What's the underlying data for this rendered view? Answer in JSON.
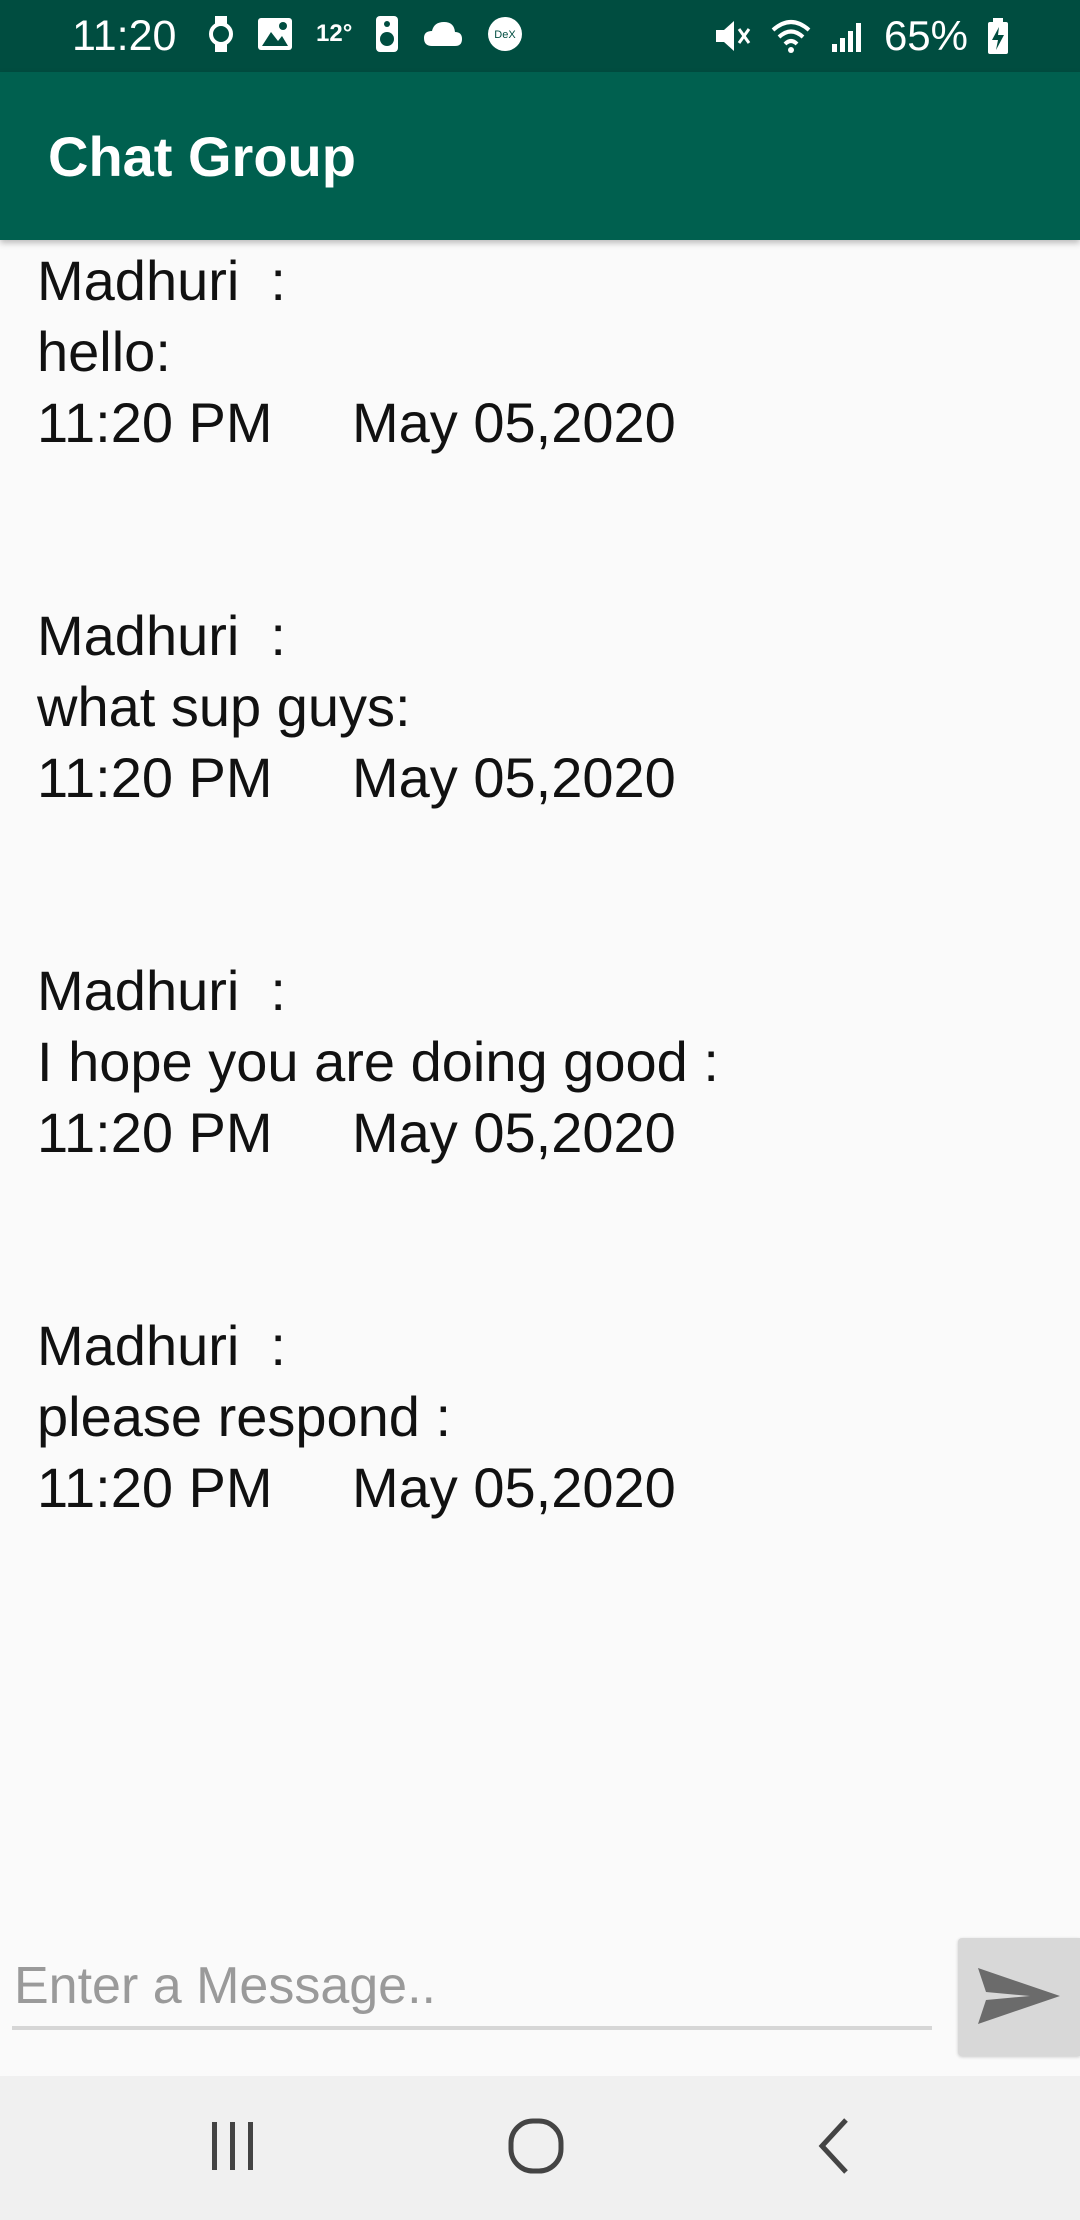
{
  "status_bar": {
    "time": "11:20",
    "temperature": "12°",
    "battery": "65%",
    "icons": [
      "watch-icon",
      "image-icon",
      "temperature-icon",
      "speaker-icon",
      "cloud-icon",
      "dex-icon",
      "mute-icon",
      "wifi-icon",
      "signal-icon",
      "battery-charging-icon"
    ],
    "dex_label": "DeX"
  },
  "app_bar": {
    "title": "Chat Group"
  },
  "messages": [
    {
      "sender": "Madhuri  :",
      "text": "hello:",
      "time": "11:20 PM",
      "date": "May 05,2020"
    },
    {
      "sender": "Madhuri  :",
      "text": "what sup guys:",
      "time": "11:20 PM",
      "date": "May 05,2020"
    },
    {
      "sender": "Madhuri  :",
      "text": "I hope you are doing good :",
      "time": "11:20 PM",
      "date": "May 05,2020"
    },
    {
      "sender": "Madhuri  :",
      "text": "please respond :",
      "time": "11:20 PM",
      "date": "May 05,2020"
    }
  ],
  "composer": {
    "placeholder": "Enter a Message..",
    "value": "",
    "send_icon": "send-icon"
  },
  "nav_bar": {
    "buttons": [
      "recent-apps-icon",
      "home-icon",
      "back-icon"
    ]
  },
  "colors": {
    "status_bar": "#004d40",
    "app_bar": "#00604f",
    "background": "#fafafa",
    "send_button": "#d8d8d8",
    "nav_bar": "#f0f0f0"
  }
}
